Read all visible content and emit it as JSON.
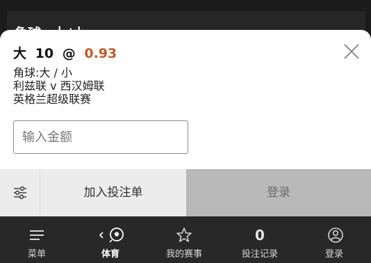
{
  "background": {
    "market_title": "角球: 大/小"
  },
  "betslip": {
    "selection_name": "大",
    "selection_line": "10",
    "at_symbol": "@",
    "odds": "0.93",
    "market": "角球:大 / 小",
    "event": "利兹联 v 西汉姆联",
    "competition": "英格兰超级联赛",
    "stake_placeholder": "输入金额"
  },
  "actions": {
    "add_to_slip_label": "加入投注单",
    "login_label": "登录"
  },
  "bottom_nav": {
    "menu": "菜单",
    "sports": "体育",
    "my_events": "我的赛事",
    "bet_count": "0",
    "bet_history": "投注记录",
    "login": "登录"
  },
  "colors": {
    "odds": "#c95a26",
    "sheet": "#ffffff",
    "nav_bg": "#282828",
    "login_button_bg": "#b9b9b9"
  },
  "icons": {
    "close": "close-icon",
    "settings": "sliders-icon",
    "menu": "hamburger-icon",
    "sports": "soccer-ball-icon",
    "back": "chevron-left-icon",
    "favorites": "star-icon",
    "account": "user-circle-icon",
    "collapse": "chevron-up-icon"
  }
}
